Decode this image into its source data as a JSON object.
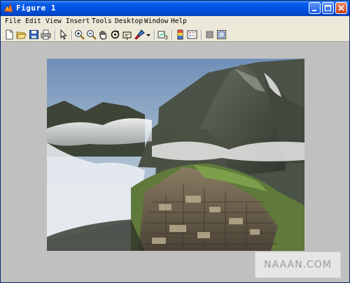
{
  "window": {
    "title": "Figure 1"
  },
  "menu": {
    "items": [
      {
        "label": "File"
      },
      {
        "label": "Edit"
      },
      {
        "label": "View"
      },
      {
        "label": "Insert"
      },
      {
        "label": "Tools"
      },
      {
        "label": "Desktop"
      },
      {
        "label": "Window"
      },
      {
        "label": "Help"
      }
    ]
  },
  "toolbar": {
    "icons": [
      "new-figure-icon",
      "open-file-icon",
      "save-icon",
      "print-icon",
      "edit-plot-arrow-icon",
      "zoom-in-icon",
      "zoom-out-icon",
      "pan-hand-icon",
      "rotate-3d-icon",
      "data-cursor-icon",
      "brush-icon",
      "brush-dropdown-icon",
      "link-plot-icon",
      "colorbar-icon",
      "legend-icon",
      "hide-plot-tools-icon",
      "show-plot-tools-icon"
    ]
  },
  "figure": {
    "content": "photograph of Machu Picchu mountain ruins with clouds"
  },
  "watermark": {
    "text": "NAAAN.COM"
  },
  "colors": {
    "titlebar": "#0054e3",
    "figure_background": "#c0c0c0",
    "menubar": "#ece9d8"
  }
}
